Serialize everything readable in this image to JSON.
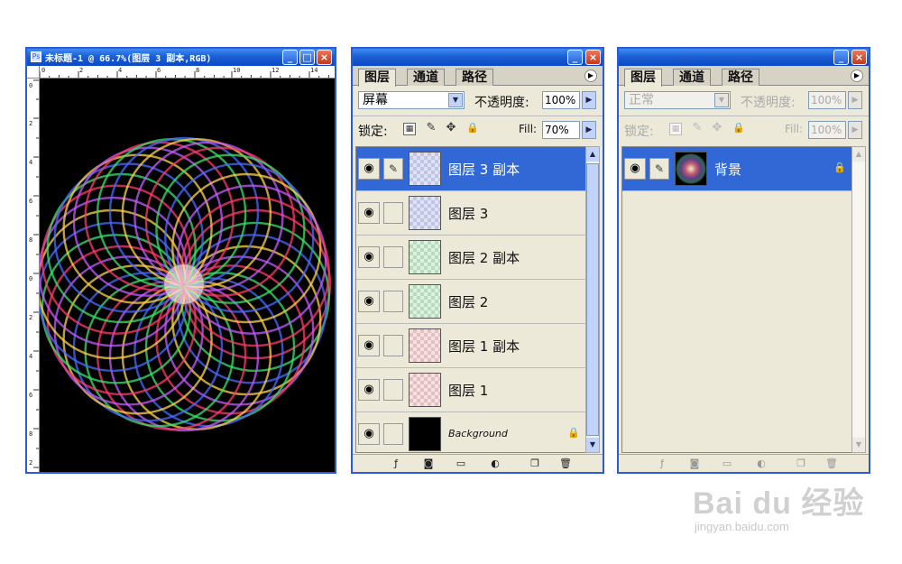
{
  "document_window": {
    "title": "未标题-1 @ 66.7%(图层 3 副本,RGB)",
    "buttons": {
      "minimize": "_",
      "maximize": "□",
      "close": "×"
    },
    "ruler_top_ticks": [
      "0",
      "2",
      "4",
      "6",
      "8",
      "10",
      "12",
      "14"
    ],
    "ruler_left_ticks": [
      "0",
      "2",
      "4",
      "6",
      "8",
      "0",
      "2",
      "4",
      "6",
      "8",
      "2"
    ]
  },
  "layers_panel_1": {
    "tabs": [
      "图层",
      "通道",
      "路径"
    ],
    "blend_mode": "屏幕",
    "opacity_label": "不透明度:",
    "opacity_value": "100%",
    "lock_label": "锁定:",
    "fill_label": "Fill:",
    "fill_value": "70%",
    "layers": [
      {
        "name": "图层 3 副本",
        "selected": true,
        "thumb": "blue"
      },
      {
        "name": "图层 3",
        "selected": false,
        "thumb": "blue"
      },
      {
        "name": "图层 2 副本",
        "selected": false,
        "thumb": "green"
      },
      {
        "name": "图层 2",
        "selected": false,
        "thumb": "green"
      },
      {
        "name": "图层 1 副本",
        "selected": false,
        "thumb": "red"
      },
      {
        "name": "图层 1",
        "selected": false,
        "thumb": "red"
      },
      {
        "name": "Background",
        "selected": false,
        "thumb": "black",
        "locked": true
      }
    ]
  },
  "layers_panel_2": {
    "tabs": [
      "图层",
      "通道",
      "路径"
    ],
    "blend_mode": "正常",
    "opacity_label": "不透明度:",
    "opacity_value": "100%",
    "lock_label": "锁定:",
    "fill_label": "Fill:",
    "fill_value": "100%",
    "layers": [
      {
        "name": "背景",
        "selected": true,
        "thumb": "spiro",
        "locked": true
      }
    ]
  },
  "watermark": {
    "brand": "Bai du 经验",
    "url": "jingyan.baidu.com"
  },
  "colors": {
    "title_blue": "#2b5bd8",
    "selection_blue": "#3168d5",
    "panel_bg": "#ece9d8",
    "canvas": "#000000"
  }
}
